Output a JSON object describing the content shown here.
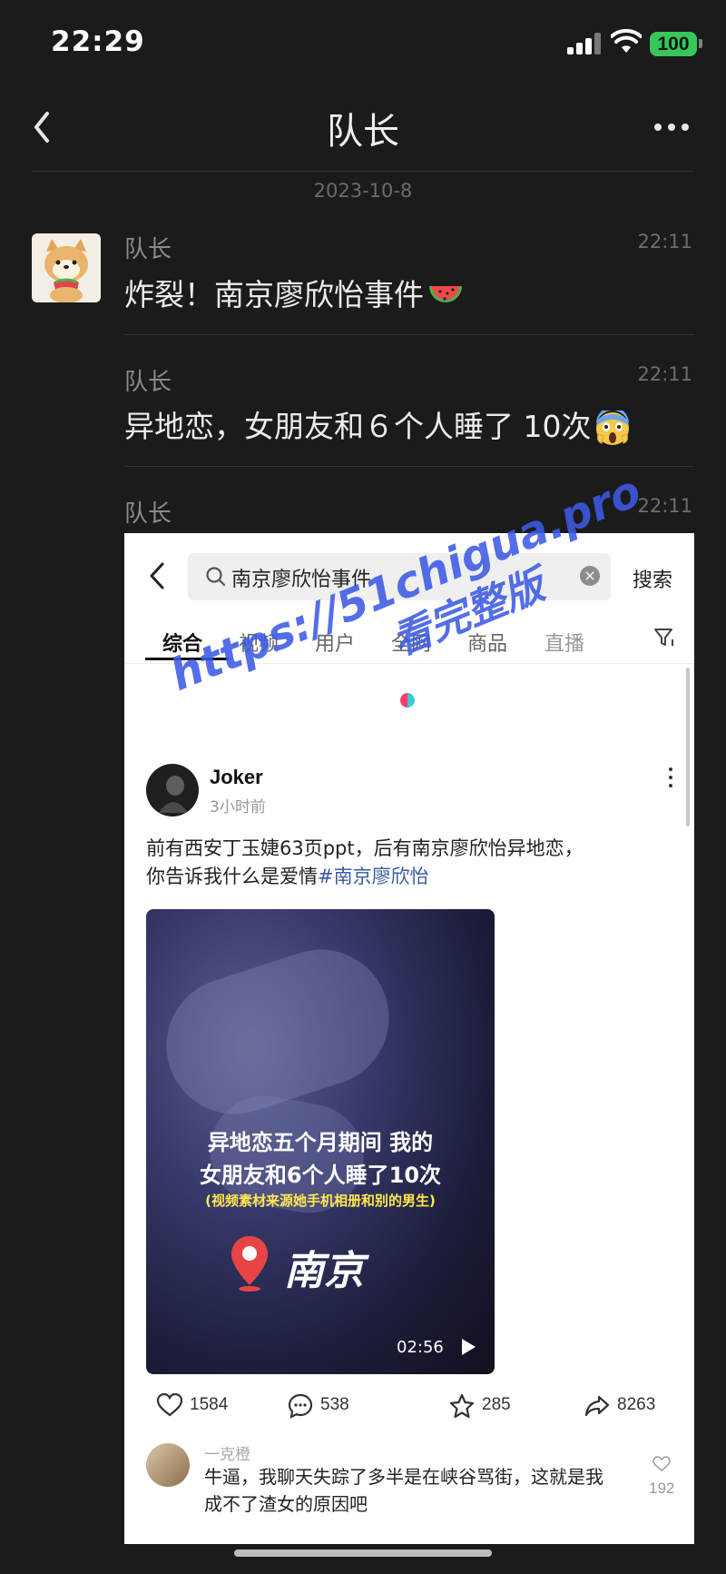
{
  "status_bar": {
    "time": "22:29",
    "battery": "100"
  },
  "nav": {
    "title": "队长"
  },
  "date_separator": "2023-10-8",
  "messages": [
    {
      "sender": "队长",
      "time": "22:11",
      "text": "炸裂！南京廖欣怡事件",
      "emoji": "watermelon"
    },
    {
      "sender": "队长",
      "time": "22:11",
      "text": "异地恋，女朋友和６个人睡了 10次",
      "emoji": "screaming-face"
    },
    {
      "sender": "队长",
      "time": "22:11"
    }
  ],
  "screenshot": {
    "search": {
      "query": "南京廖欣怡事件",
      "button": "搜索"
    },
    "tabs": [
      "综合",
      "视频",
      "用户",
      "全网",
      "商品",
      "直播"
    ],
    "active_tab": "综合",
    "post": {
      "author": "Joker",
      "time": "3小时前",
      "text": "前有西安丁玉婕63页ppt，后有南京廖欣怡异地恋，你告诉我什么是爱情",
      "hashtag": "#南京廖欣怡",
      "video": {
        "line1": "异地恋五个月期间 我的",
        "line2": "女朋友和6个人睡了10次",
        "line3": "(视频素材来源她手机相册和别的男生)",
        "city": "南京",
        "duration": "02:56"
      },
      "actions": {
        "likes": "1584",
        "comments": "538",
        "favorites": "285",
        "shares": "8263"
      }
    },
    "comment": {
      "user": "一克橙",
      "text": "牛逼，我聊天失踪了多半是在峡谷骂街，这就是我成不了渣女的原因吧",
      "likes": "192"
    }
  },
  "watermark": {
    "line1": "https://51chigua.pro",
    "line2": "看完整版"
  },
  "colors": {
    "background": "#1b1b1b",
    "battery": "#35c759",
    "watermark": "#3c5ae6",
    "hashtag": "#3a5ba0"
  }
}
